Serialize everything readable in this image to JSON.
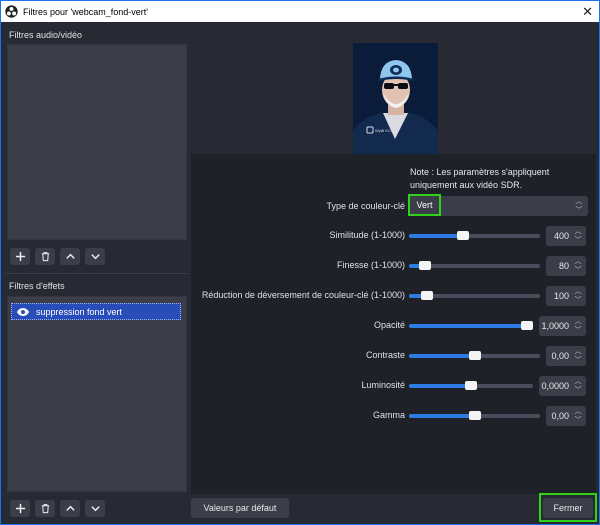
{
  "window": {
    "title": "Filtres pour 'webcam_fond-vert'",
    "close_glyph": "✕"
  },
  "left_panel": {
    "audio_video_label": "Filtres audio/vidéo",
    "effects_label": "Filtres d'effets",
    "effect_filters": [
      {
        "label": "suppression fond vert",
        "visible": true,
        "selected": true
      }
    ],
    "toolbar_icons": [
      "add-icon",
      "trash-icon",
      "chevron-up-icon",
      "chevron-down-icon"
    ]
  },
  "preview": {
    "overlay_text": "Wyliii KCM"
  },
  "settings": {
    "note": [
      "Note : Les paramètres s'appliquent",
      "uniquement aux vidéo SDR."
    ],
    "key_color_type": {
      "label": "Type de couleur-clé",
      "value": "Vert"
    },
    "params": [
      {
        "id": "similarity",
        "label": "Similitude (1-1000)",
        "value": "400",
        "level": 0.4
      },
      {
        "id": "smoothness",
        "label": "Finesse (1-1000)",
        "value": "80",
        "level": 0.08
      },
      {
        "id": "spill",
        "label": "Réduction de déversement de couleur-clé (1-1000)",
        "value": "100",
        "level": 0.1
      },
      {
        "id": "opacity",
        "label": "Opacité",
        "value": "1,0000",
        "level": 1.0
      },
      {
        "id": "contrast",
        "label": "Contraste",
        "value": "0,00",
        "level": 0.5
      },
      {
        "id": "brightness",
        "label": "Luminosité",
        "value": "0,0000",
        "level": 0.5
      },
      {
        "id": "gamma",
        "label": "Gamma",
        "value": "0,00",
        "level": 0.5
      }
    ]
  },
  "footer": {
    "defaults_label": "Valeurs par défaut",
    "close_label": "Fermer"
  },
  "colors": {
    "accent": "#2e7be6",
    "highlight": "#2fd119",
    "selection": "#284cb8"
  }
}
